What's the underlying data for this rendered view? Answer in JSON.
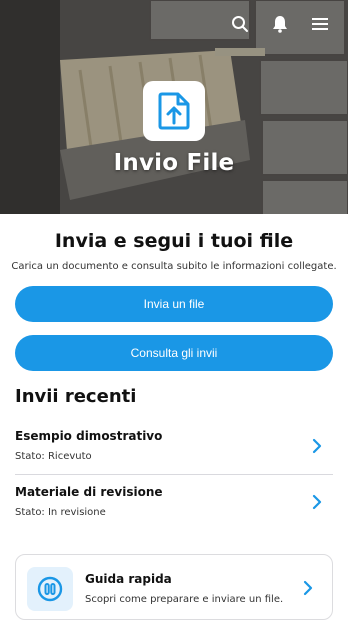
{
  "hero": {
    "title": "Invio File",
    "icons": {
      "search": "search-icon",
      "notifications": "bell-icon",
      "menu": "hamburger-menu-icon",
      "app": "file-upload-icon"
    }
  },
  "intro": {
    "headline": "Invia e segui i tuoi file",
    "subhead": "Carica un documento e consulta subito le informazioni collegate."
  },
  "actions": {
    "send_label": "Invia un file",
    "view_label": "Consulta gli invii"
  },
  "recent": {
    "title": "Invii recenti",
    "items": [
      {
        "title": "Esempio dimostrativo",
        "status": "Stato: Ricevuto"
      },
      {
        "title": "Materiale di revisione",
        "status": "Stato: In revisione"
      }
    ]
  },
  "guide": {
    "title": "Guida rapida",
    "text": "Scopri come preparare e inviare un file."
  },
  "colors": {
    "accent": "#1a97e6",
    "icon_bg": "#e3f1fc",
    "text": "#111111"
  }
}
